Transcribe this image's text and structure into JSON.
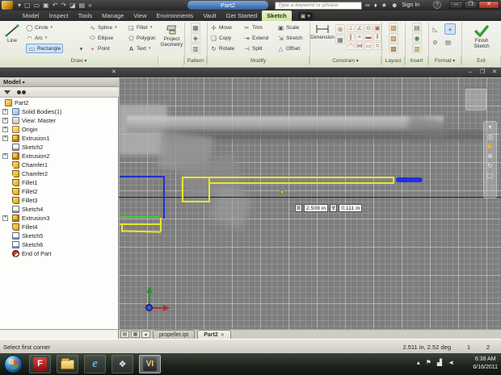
{
  "titlebar": {
    "title": "Part2",
    "search_placeholder": "Type a keyword or phrase",
    "sign_in": "Sign In",
    "help": "?"
  },
  "ribbon_tabs": {
    "items": [
      {
        "label": "Model"
      },
      {
        "label": "Inspect"
      },
      {
        "label": "Tools"
      },
      {
        "label": "Manage"
      },
      {
        "label": "View"
      },
      {
        "label": "Environments"
      },
      {
        "label": "Vault"
      },
      {
        "label": "Get Started"
      },
      {
        "label": "Sketch",
        "active": true
      }
    ]
  },
  "ribbon": {
    "draw": {
      "panel_label": "Draw",
      "line": "Line",
      "circle": "Circle",
      "arc": "Arc",
      "rectangle": "Rectangle",
      "spline": "Spline",
      "ellipse": "Ellipse",
      "point": "Point",
      "fillet": "Fillet",
      "polygon": "Polygon",
      "text": "Text",
      "project_geometry": "Project Geometry"
    },
    "pattern": {
      "panel_label": "Pattern"
    },
    "modify": {
      "panel_label": "Modify",
      "move": "Move",
      "copy": "Copy",
      "rotate": "Rotate",
      "trim": "Trim",
      "extend": "Extend",
      "split": "Split",
      "scale": "Scale",
      "stretch": "Stretch",
      "offset": "Offset"
    },
    "constrain": {
      "panel_label": "Constrain",
      "dimension": "Dimension"
    },
    "layout": {
      "panel_label": "Layout"
    },
    "insert": {
      "panel_label": "Insert"
    },
    "format": {
      "panel_label": "Format"
    },
    "exit": {
      "panel_label": "Exit",
      "finish_sketch": "Finish Sketch"
    }
  },
  "browser": {
    "header": "Model",
    "items": [
      {
        "label": "Part2"
      },
      {
        "label": "Solid Bodies(1)"
      },
      {
        "label": "View: Master"
      },
      {
        "label": "Origin"
      },
      {
        "label": "Extrusion1"
      },
      {
        "label": "Sketch2"
      },
      {
        "label": "Extrusion2"
      },
      {
        "label": "Chamfer1"
      },
      {
        "label": "Chamfer2"
      },
      {
        "label": "Fillet1"
      },
      {
        "label": "Fillet2"
      },
      {
        "label": "Fillet3"
      },
      {
        "label": "Sketch4"
      },
      {
        "label": "Extrusion3"
      },
      {
        "label": "Fillet4"
      },
      {
        "label": "Sketch5"
      },
      {
        "label": "Sketch6"
      },
      {
        "label": "End of Part"
      }
    ]
  },
  "canvas": {
    "tooltip": {
      "x_label": "X",
      "x_value": "2.508 in",
      "y_label": "Y",
      "y_value": "0.111 in"
    }
  },
  "doc_tabs": {
    "tab1": "propeller.ipt",
    "tab2": "Part2"
  },
  "statusbar": {
    "message": "Select first corner",
    "coords": "2.511 in, 2.52 deg",
    "field1": "1",
    "field2": "2"
  },
  "taskbar": {
    "time": "6:38 AM",
    "date": "6/16/2011"
  }
}
